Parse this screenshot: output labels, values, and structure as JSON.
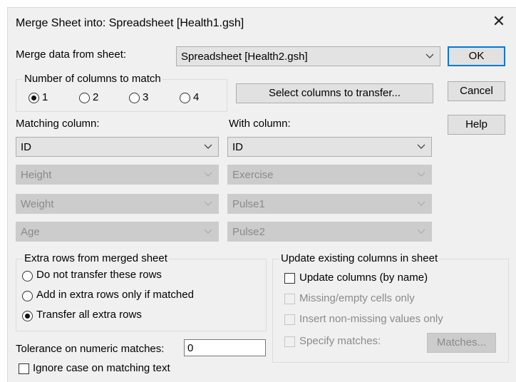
{
  "title": "Merge Sheet into: Spreadsheet [Health1.gsh]",
  "close_glyph": "✕",
  "merge_from": {
    "label": "Merge data from sheet:",
    "value": "Spreadsheet [Health2.gsh]"
  },
  "buttons": {
    "ok": "OK",
    "cancel": "Cancel",
    "help": "Help",
    "select_columns": "Select columns to transfer...",
    "matches": "Matches..."
  },
  "num_columns": {
    "title": "Number of columns to match",
    "options": [
      "1",
      "2",
      "3",
      "4"
    ],
    "selected": "1"
  },
  "matching_label": "Matching column:",
  "with_label": "With column:",
  "matching_columns": [
    {
      "value": "ID",
      "enabled": true
    },
    {
      "value": "Height",
      "enabled": false
    },
    {
      "value": "Weight",
      "enabled": false
    },
    {
      "value": "Age",
      "enabled": false
    }
  ],
  "with_columns": [
    {
      "value": "ID",
      "enabled": true
    },
    {
      "value": "Exercise",
      "enabled": false
    },
    {
      "value": "Pulse1",
      "enabled": false
    },
    {
      "value": "Pulse2",
      "enabled": false
    }
  ],
  "extra_rows": {
    "title": "Extra rows from merged sheet",
    "options": [
      "Do not transfer these rows",
      "Add in extra rows only if matched",
      "Transfer all extra rows"
    ],
    "selected": "Transfer all extra rows"
  },
  "update_existing": {
    "title": "Update existing columns in sheet",
    "update_by_name": {
      "label": "Update columns (by name)",
      "checked": false,
      "enabled": true
    },
    "missing_only": {
      "label": "Missing/empty cells only",
      "checked": false,
      "enabled": false
    },
    "insert_non_missing": {
      "label": "Insert non-missing values only",
      "checked": false,
      "enabled": false
    },
    "specify_matches": {
      "label": "Specify matches:",
      "checked": false,
      "enabled": false
    }
  },
  "tolerance": {
    "label": "Tolerance on numeric matches:",
    "value": "0"
  },
  "ignore_case": {
    "label": "Ignore case on matching text",
    "checked": false
  }
}
